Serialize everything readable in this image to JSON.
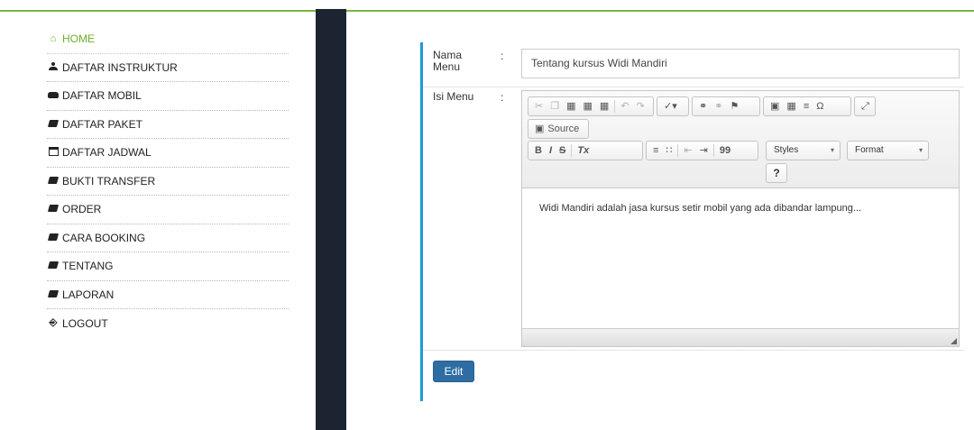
{
  "sidebar": {
    "items": [
      {
        "label": "HOME",
        "icon": "home-icon"
      },
      {
        "label": "DAFTAR INSTRUKTUR",
        "icon": "user-icon"
      },
      {
        "label": "DAFTAR MOBIL",
        "icon": "car-icon"
      },
      {
        "label": "DAFTAR PAKET",
        "icon": "book-icon"
      },
      {
        "label": "DAFTAR JADWAL",
        "icon": "calendar-icon"
      },
      {
        "label": "BUKTI TRANSFER",
        "icon": "book-icon"
      },
      {
        "label": "ORDER",
        "icon": "book-icon"
      },
      {
        "label": "CARA BOOKING",
        "icon": "book-icon"
      },
      {
        "label": "TENTANG",
        "icon": "book-icon"
      },
      {
        "label": "LAPORAN",
        "icon": "book-icon"
      },
      {
        "label": "LOGOUT",
        "icon": "key-icon"
      }
    ]
  },
  "form": {
    "nama_label_1": "Nama",
    "nama_label_2": "Menu",
    "colon": ":",
    "nama_value": "Tentang kursus Widi Mandiri",
    "isi_label": "Isi Menu",
    "isi_value": "Widi Mandiri adalah jasa kursus setir mobil yang ada dibandar lampung...",
    "submit_label": "Edit"
  },
  "editor": {
    "source_label": "Source",
    "styles_label": "Styles",
    "format_label": "Format",
    "help_label": "?",
    "bold": "B",
    "italic": "I",
    "strike": "S",
    "remove_format": "Tx",
    "blockquote": "99"
  },
  "colors": {
    "accent_green": "#6cae2c",
    "panel_accent": "#1b9bd7",
    "button_blue": "#2e6da4",
    "dark_column": "#1d2431"
  }
}
